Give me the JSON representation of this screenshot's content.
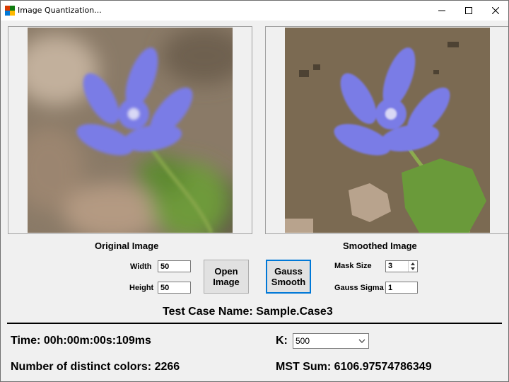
{
  "window": {
    "title": "Image Quantization..."
  },
  "panels": {
    "original_caption": "Original Image",
    "smoothed_caption": "Smoothed Image"
  },
  "controls": {
    "width_label": "Width",
    "width_value": "50",
    "height_label": "Height",
    "height_value": "50",
    "open_button_line1": "Open",
    "open_button_line2": "Image",
    "gauss_button_line1": "Gauss",
    "gauss_button_line2": "Smooth",
    "mask_label": "Mask Size",
    "mask_value": "3",
    "sigma_label": "Gauss Sigma",
    "sigma_value": "1"
  },
  "test_case": "Test Case Name: Sample.Case3",
  "results": {
    "time": "Time: 00h:00m:00s:109ms",
    "k_label": "K:",
    "k_value": "500",
    "distinct": "Number of distinct colors: 2266",
    "mst": "MST Sum: 6106.97574786349"
  },
  "colors": {
    "accent": "#0078d7",
    "flower": "#7a7be6",
    "leaf": "#6e9a3a",
    "smoothed_bg": "#7b6a52"
  }
}
